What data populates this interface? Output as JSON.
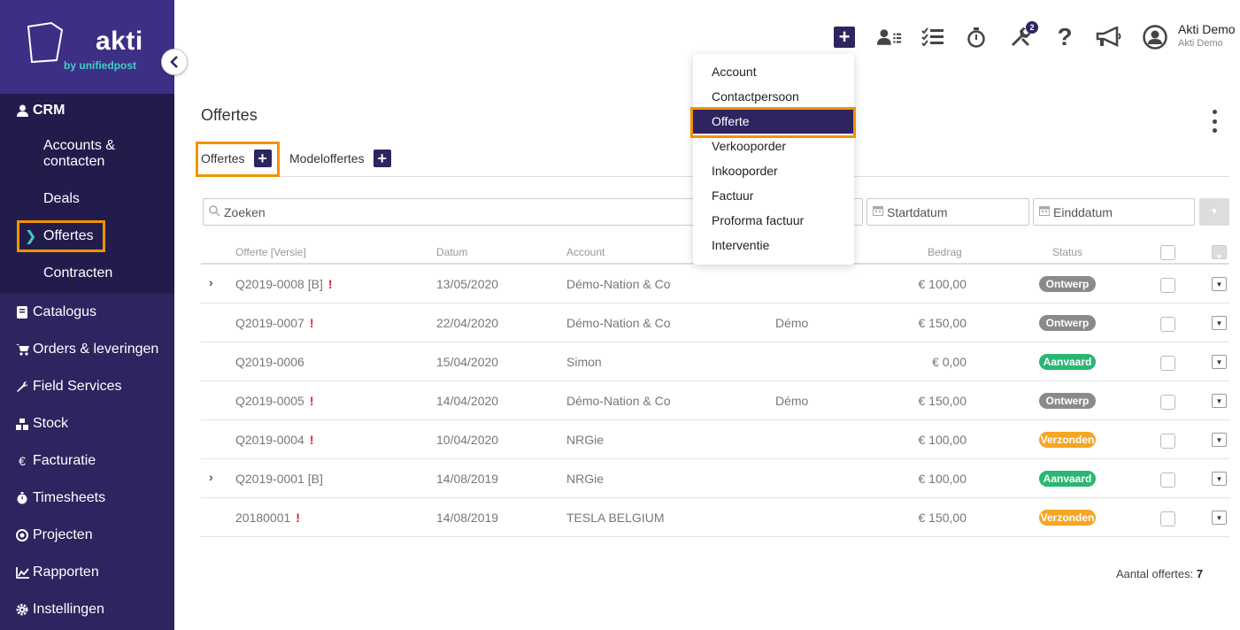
{
  "brand": {
    "name": "akti",
    "sub_prefix": "by",
    "sub_name": "unifiedpost"
  },
  "sidebar": {
    "crm_label": "CRM",
    "crm_items": [
      "Accounts & contacten",
      "Deals",
      "Offertes",
      "Contracten"
    ],
    "items": [
      {
        "label": "Catalogus",
        "icon": "book-icon"
      },
      {
        "label": "Orders & leveringen",
        "icon": "cart-icon"
      },
      {
        "label": "Field Services",
        "icon": "wrench-icon"
      },
      {
        "label": "Stock",
        "icon": "cubes-icon"
      },
      {
        "label": "Facturatie",
        "icon": "euro-icon"
      },
      {
        "label": "Timesheets",
        "icon": "stopwatch-icon"
      },
      {
        "label": "Projecten",
        "icon": "target-icon"
      },
      {
        "label": "Rapporten",
        "icon": "chart-icon"
      },
      {
        "label": "Instellingen",
        "icon": "gear-icon"
      }
    ]
  },
  "topbar": {
    "badge": "2",
    "user_name": "Akti Demo",
    "user_sub": "Akti Demo"
  },
  "menu": {
    "items": [
      "Account",
      "Contactpersoon",
      "Offerte",
      "Verkooporder",
      "Inkooporder",
      "Factuur",
      "Proforma factuur",
      "Interventie"
    ],
    "active_index": 2
  },
  "page": {
    "title": "Offertes"
  },
  "tabs": [
    {
      "label": "Offertes"
    },
    {
      "label": "Modeloffertes"
    }
  ],
  "filters": {
    "search_placeholder": "Zoeken",
    "start_placeholder": "Startdatum",
    "end_placeholder": "Einddatum"
  },
  "table": {
    "headers": [
      "Offerte [Versie]",
      "Datum",
      "Account",
      "Bedrag",
      "Status"
    ],
    "rows": [
      {
        "id": "Q2019-0008 [B]",
        "warn": true,
        "expand": true,
        "date": "13/05/2020",
        "account": "Démo-Nation & Co",
        "contact": "",
        "amount": "€ 100,00",
        "status": "Ontwerp"
      },
      {
        "id": "Q2019-0007",
        "warn": true,
        "expand": false,
        "date": "22/04/2020",
        "account": "Démo-Nation & Co",
        "contact": "Démo",
        "amount": "€ 150,00",
        "status": "Ontwerp"
      },
      {
        "id": "Q2019-0006",
        "warn": false,
        "expand": false,
        "date": "15/04/2020",
        "account": "Simon",
        "contact": "",
        "amount": "€ 0,00",
        "status": "Aanvaard"
      },
      {
        "id": "Q2019-0005",
        "warn": true,
        "expand": false,
        "date": "14/04/2020",
        "account": "Démo-Nation & Co",
        "contact": "Démo",
        "amount": "€ 150,00",
        "status": "Ontwerp"
      },
      {
        "id": "Q2019-0004",
        "warn": true,
        "expand": false,
        "date": "10/04/2020",
        "account": "NRGie",
        "contact": "",
        "amount": "€ 100,00",
        "status": "Verzonden"
      },
      {
        "id": "Q2019-0001 [B]",
        "warn": false,
        "expand": true,
        "date": "14/08/2019",
        "account": "NRGie",
        "contact": "",
        "amount": "€ 100,00",
        "status": "Aanvaard"
      },
      {
        "id": "20180001",
        "warn": true,
        "expand": false,
        "date": "14/08/2019",
        "account": "TESLA BELGIUM",
        "contact": "",
        "amount": "€ 150,00",
        "status": "Verzonden"
      }
    ]
  },
  "status_colors": {
    "Ontwerp": "#8a8a8a",
    "Aanvaard": "#2bb673",
    "Verzonden": "#f5a623"
  },
  "footer": {
    "count_label": "Aantal offertes:",
    "count": "7"
  }
}
